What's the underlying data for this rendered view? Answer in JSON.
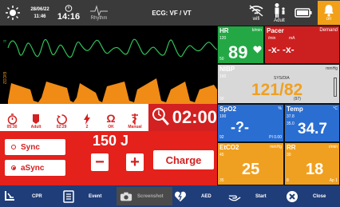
{
  "topbar": {
    "date": "28/06/22",
    "time_small": "11:46",
    "timer": "14:16",
    "rhythm_label": "Rhythm",
    "title": "ECG: VF / VT",
    "wifi_label": "wifi",
    "adult_label": "Adult",
    "alarm_label": "on"
  },
  "waves": {
    "ecg_lead": "II",
    "etco2_label": "EtCO2"
  },
  "hr": {
    "title": "HR",
    "unit": "b/min",
    "upper": "120",
    "lower": "50",
    "value": "89",
    "color": "#23a845"
  },
  "pacer": {
    "title": "Pacer",
    "mode": "Demand",
    "unit1": "/min",
    "unit2": "mA",
    "value": "-x- -x-",
    "color": "#ffffff"
  },
  "nibp": {
    "title": "NIBP",
    "unit": "mmHg",
    "upper": "160",
    "lower": "90",
    "sub": "SYS/DIA",
    "value": "121/82",
    "mean": "(97)",
    "color": "#d8d8d8",
    "accent": "#f0a020"
  },
  "spo2": {
    "title": "SpO2",
    "unit": "%",
    "upper": "100",
    "lower": "92",
    "pi": "PI 0.00",
    "value": "-?-",
    "color": "#2a6ed2"
  },
  "temp": {
    "title": "Temp",
    "unit": "°C",
    "upper": "37.8",
    "lower": "35.0",
    "value": "34.7",
    "color": "#2a6ed2"
  },
  "etco2": {
    "title": "EtCO2",
    "unit": "mmHg",
    "upper": "45",
    "lower": "35",
    "value": "25",
    "color": "#f0a020"
  },
  "rr": {
    "title": "RR",
    "unit": "r/min",
    "upper": "30",
    "lower": "8",
    "value": "18",
    "extra": "Ap 1",
    "color": "#f0a020"
  },
  "controls": {
    "items": [
      "05:30",
      "Adult",
      "02:29",
      "2",
      "OK",
      "Manual"
    ],
    "countdown": "02:00"
  },
  "defib": {
    "sync_label": "Sync",
    "async_label": "aSync",
    "energy": "150 J",
    "minus": "−",
    "plus": "+",
    "charge_label": "Charge"
  },
  "bottom": {
    "cpr": "CPR",
    "event": "Event",
    "screenshot": "Screenshot",
    "aed": "AED",
    "start": "Start",
    "close": "Close"
  }
}
